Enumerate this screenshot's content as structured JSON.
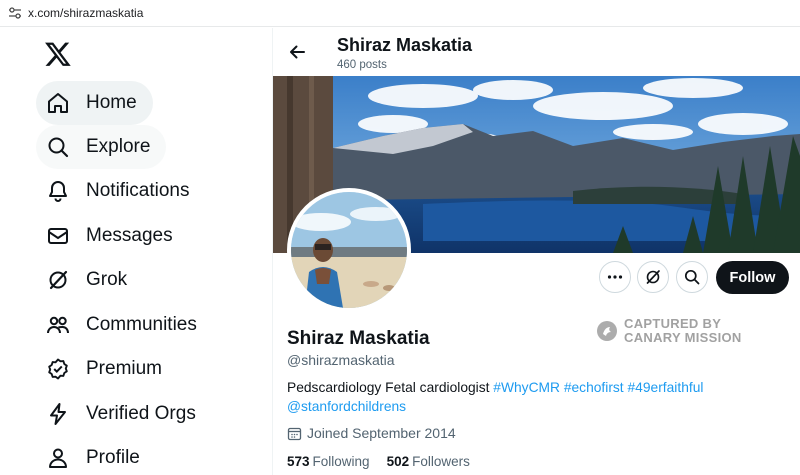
{
  "browser": {
    "url": "x.com/shirazmaskatia"
  },
  "sidebar": {
    "items": [
      {
        "label": "Home",
        "icon": "home-icon"
      },
      {
        "label": "Explore",
        "icon": "search-icon"
      },
      {
        "label": "Notifications",
        "icon": "bell-icon"
      },
      {
        "label": "Messages",
        "icon": "envelope-icon"
      },
      {
        "label": "Grok",
        "icon": "grok-icon"
      },
      {
        "label": "Communities",
        "icon": "people-icon"
      },
      {
        "label": "Premium",
        "icon": "verified-badge-icon"
      },
      {
        "label": "Verified Orgs",
        "icon": "lightning-icon"
      },
      {
        "label": "Profile",
        "icon": "person-icon"
      }
    ]
  },
  "header": {
    "name": "Shiraz Maskatia",
    "posts": "460 posts"
  },
  "profile": {
    "name": "Shiraz Maskatia",
    "handle": "@shirazmaskatia",
    "bio_text": "Pedscardiology Fetal cardiologist ",
    "bio_tags": [
      "#WhyCMR",
      "#echofirst",
      "#49erfaithful",
      "@stanfordchildrens"
    ],
    "joined": "Joined September 2014",
    "following_count": "573",
    "following_label": "Following",
    "followers_count": "502",
    "followers_label": "Followers",
    "follow_button": "Follow"
  },
  "watermark": {
    "line1": "CAPTURED BY",
    "line2": "CANARY MISSION"
  },
  "colors": {
    "accent": "#1d9bf0",
    "text": "#0f1419",
    "muted": "#536471",
    "follow_bg": "#0f1419"
  }
}
